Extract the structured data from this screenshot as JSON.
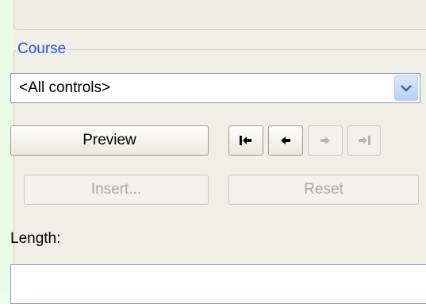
{
  "course": {
    "legend": "Course",
    "dropdown": {
      "selected": "<All controls>"
    }
  },
  "buttons": {
    "preview": "Preview",
    "insert": "Insert...",
    "reset": "Reset"
  },
  "icons": {
    "first": "skip-to-first-icon",
    "previous": "previous-icon",
    "next": "next-icon",
    "last": "skip-to-last-icon",
    "dropdown": "chevron-down-icon"
  },
  "length": {
    "label": "Length:",
    "value": ""
  },
  "colors": {
    "legend": "#2553d6",
    "background": "#f0efe6"
  }
}
